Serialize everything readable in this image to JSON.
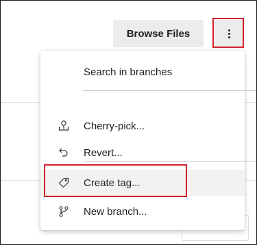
{
  "toolbar": {
    "browse_files_label": "Browse Files",
    "more_actions_icon": "more-vertical-icon"
  },
  "menu": {
    "items": [
      {
        "label": "Search in branches",
        "icon": null
      },
      {
        "label": "Cherry-pick...",
        "icon": "cherry-pick-icon"
      },
      {
        "label": "Revert...",
        "icon": "revert-icon"
      },
      {
        "label": "Create tag...",
        "icon": "tag-icon"
      },
      {
        "label": "New branch...",
        "icon": "branch-icon"
      }
    ]
  },
  "colors": {
    "highlight_border": "#d1212a",
    "button_bg": "#ececec",
    "hover_bg": "#f3f2f1"
  }
}
